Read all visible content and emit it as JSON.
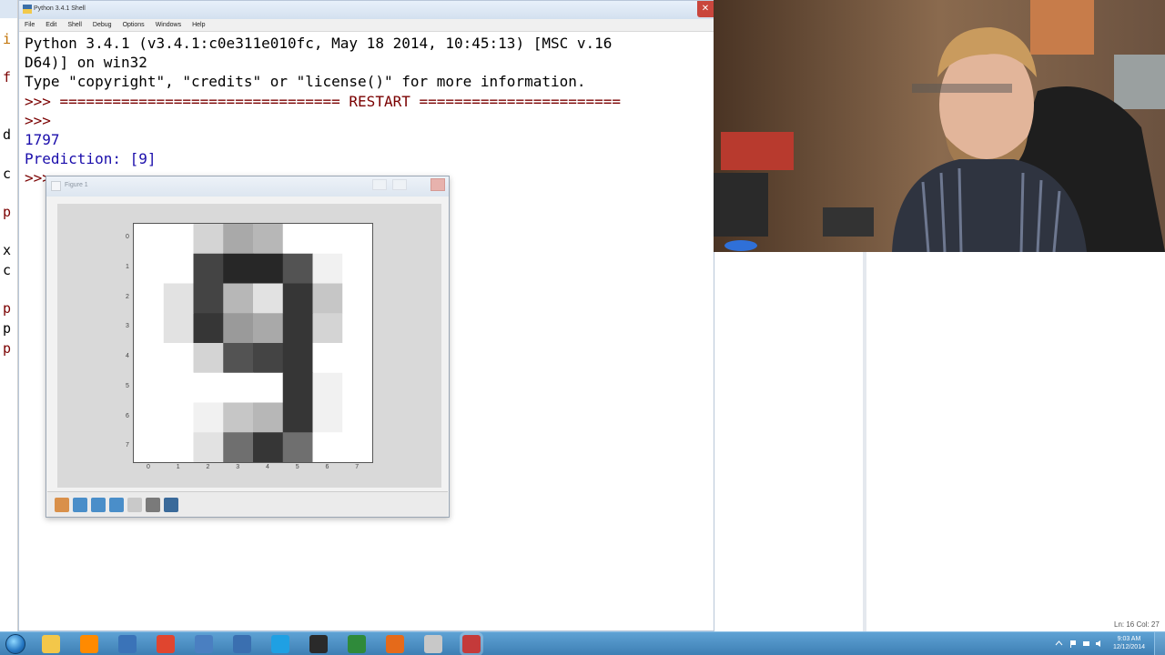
{
  "shell": {
    "title": "Python 3.4.1 Shell",
    "menu": [
      "File",
      "Edit",
      "Shell",
      "Debug",
      "Options",
      "Windows",
      "Help"
    ],
    "lines": [
      {
        "text": "Python 3.4.1 (v3.4.1:c0e311e010fc, May 18 2014, 10:45:13) [MSC v.16",
        "kind": "out"
      },
      {
        "text": "D64)] on win32",
        "kind": "out"
      },
      {
        "text": "Type \"copyright\", \"credits\" or \"license()\" for more information.",
        "kind": "out"
      },
      {
        "text": ">>> ================================ RESTART =======================",
        "kind": "restart"
      },
      {
        "text": ">>> ",
        "kind": "prompt"
      },
      {
        "text": "1797",
        "kind": "stdout"
      },
      {
        "text": "Prediction: [9]",
        "kind": "stdout"
      },
      {
        "text": ">>> ",
        "kind": "prompt"
      }
    ]
  },
  "background_editor": {
    "line_starts": [
      "i",
      "f",
      "d",
      "c",
      "p",
      "x",
      "c",
      "p",
      "p",
      "p"
    ]
  },
  "right_window": {
    "status": "Ln: 16 Col: 27"
  },
  "figure": {
    "title": "Figure 1",
    "pixel_grid": [
      [
        0,
        0,
        3,
        6,
        5,
        0,
        0,
        0
      ],
      [
        0,
        0,
        13,
        15,
        15,
        12,
        1,
        0
      ],
      [
        0,
        2,
        13,
        5,
        2,
        14,
        4,
        0
      ],
      [
        0,
        2,
        14,
        7,
        6,
        14,
        3,
        0
      ],
      [
        0,
        0,
        3,
        12,
        13,
        14,
        0,
        0
      ],
      [
        0,
        0,
        0,
        0,
        0,
        14,
        1,
        0
      ],
      [
        0,
        0,
        1,
        4,
        5,
        14,
        1,
        0
      ],
      [
        0,
        0,
        2,
        10,
        14,
        10,
        0,
        0
      ]
    ],
    "x_ticks": [
      "0",
      "1",
      "2",
      "3",
      "4",
      "5",
      "6",
      "7"
    ],
    "y_ticks": [
      "0",
      "1",
      "2",
      "3",
      "4",
      "5",
      "6",
      "7"
    ],
    "toolbar": [
      "home-icon",
      "back-icon",
      "forward-icon",
      "pan-icon",
      "zoom-icon",
      "subplots-icon",
      "save-icon"
    ]
  },
  "taskbar": {
    "apps": [
      "explorer",
      "media-player",
      "python-idle",
      "chrome",
      "python-alt",
      "python-file",
      "skype",
      "app-v",
      "app-green",
      "firefox",
      "settings",
      "python-active"
    ],
    "clock": {
      "time": "9:03 AM",
      "date": "12/12/2014"
    }
  },
  "colors": {
    "taskbar": "#4a8cc4",
    "shell_prompt": "#7a0000",
    "shell_stdout": "#1a0dab"
  }
}
